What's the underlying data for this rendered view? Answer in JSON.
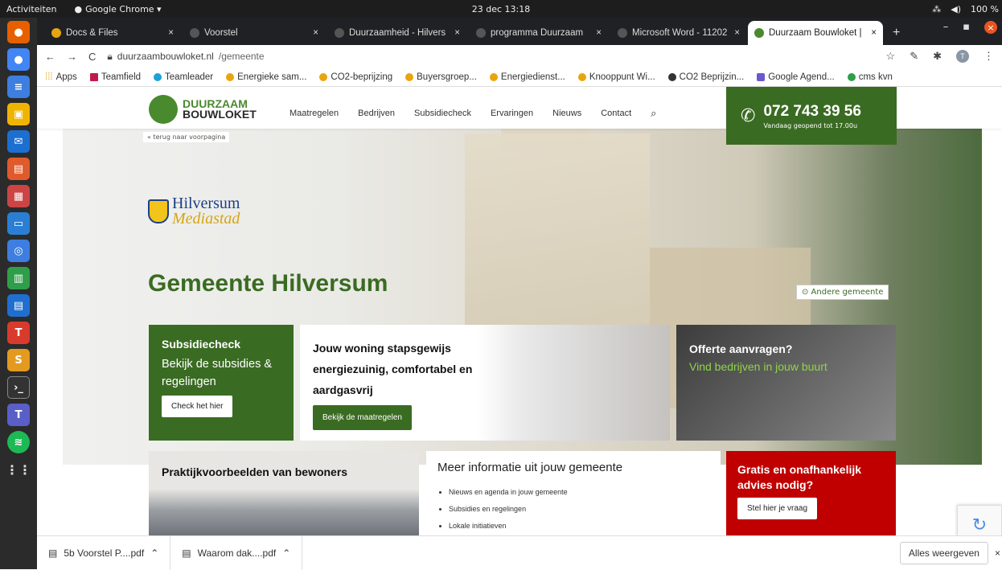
{
  "system": {
    "activities": "Activiteiten",
    "app_name": "Google Chrome ▾",
    "clock": "23 dec 13:18",
    "battery": "100 %"
  },
  "tabs": [
    {
      "label": "Docs & Files",
      "favicon_color": "#e8a50e"
    },
    {
      "label": "Voorstel",
      "favicon_color": "#555555"
    },
    {
      "label": "Duurzaamheid - Hilvers",
      "favicon_color": "#555555"
    },
    {
      "label": "programma Duurzaam",
      "favicon_color": "#555555"
    },
    {
      "label": "Microsoft Word - 11202",
      "favicon_color": "#555555"
    },
    {
      "label": "Duurzaam Bouwloket |",
      "favicon_color": "#4a8a2e"
    }
  ],
  "address": {
    "domain": "duurzaambouwloket.nl",
    "path": "/gemeente"
  },
  "bookmarks": [
    "Apps",
    "Teamfield",
    "Teamleader",
    "Energieke sam...",
    "CO2-beprijzing",
    "Buyersgroep...",
    "Energiedienst...",
    "Knooppunt Wi...",
    "CO2 Beprijzin...",
    "Google Agend...",
    "cms kvn"
  ],
  "site": {
    "logo_line1": "DUURZAAM",
    "logo_line2": "BOUWLOKET",
    "back_link": "« terug naar voorpagina",
    "nav": [
      "Maatregelen",
      "Bedrijven",
      "Subsidiecheck",
      "Ervaringen",
      "Nieuws",
      "Contact"
    ],
    "phone": "072 743 39 56",
    "phone_sub": "Vandaag geopend tot 17.00u"
  },
  "hero": {
    "municipality_name": "Hilversum",
    "municipality_tagline": "Mediastad",
    "title": "Gemeente Hilversum",
    "other_municipality": "⊙ Andere gemeente"
  },
  "cards": {
    "subsidie": {
      "title": "Subsidiecheck",
      "text": "Bekijk de subsidies & regelingen",
      "button": "Check het hier"
    },
    "woning": {
      "title": "Jouw woning stapsgewijs energiezuinig, comfortabel en aardgasvrij",
      "button": "Bekijk de maatregelen"
    },
    "offerte": {
      "title": "Offerte aanvragen?",
      "subtitle": "Vind bedrijven in jouw buurt"
    },
    "praktijk": {
      "title": "Praktijkvoorbeelden van bewoners"
    },
    "info": {
      "title": "Meer informatie uit jouw gemeente",
      "items": [
        "Nieuws en agenda in jouw gemeente",
        "Subsidies en regelingen",
        "Lokale initiatieven"
      ]
    },
    "advies": {
      "title": "Gratis en onafhankelijk advies nodig?",
      "button": "Stel hier je vraag"
    }
  },
  "downloads": {
    "items": [
      "5b Voorstel P....pdf",
      "Waarom dak....pdf"
    ],
    "show_all": "Alles weergeven"
  },
  "colors": {
    "brand_green": "#3a6b22",
    "advice_red": "#c00000"
  }
}
